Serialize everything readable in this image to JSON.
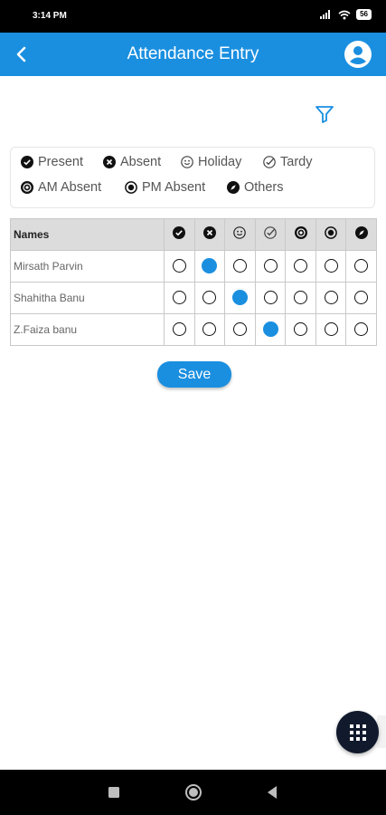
{
  "status_bar": {
    "time": "3:14 PM",
    "battery": "56",
    "icons": [
      "signal-icon",
      "wifi-icon",
      "battery-icon"
    ]
  },
  "header": {
    "title": "Attendance Entry",
    "back_icon": "chevron-left-icon",
    "profile_icon": "account-circle-icon",
    "color": "#1a8fe0"
  },
  "filter": {
    "icon": "filter-icon"
  },
  "legend": {
    "items": [
      {
        "label": "Present",
        "icon": "check-circle-icon"
      },
      {
        "label": "Absent",
        "icon": "x-circle-icon"
      },
      {
        "label": "Holiday",
        "icon": "smiley-icon"
      },
      {
        "label": "Tardy",
        "icon": "check-outline-icon"
      },
      {
        "label": "AM Absent",
        "icon": "target-icon"
      },
      {
        "label": "PM Absent",
        "icon": "radio-dot-icon"
      },
      {
        "label": "Others",
        "icon": "compass-icon"
      }
    ]
  },
  "table": {
    "names_header": "Names",
    "rows": [
      {
        "name": "Mirsath Parvin",
        "selected": 1
      },
      {
        "name": "Shahitha Banu",
        "selected": 2
      },
      {
        "name": "Z.Faiza banu",
        "selected": 3
      }
    ]
  },
  "save_label": "Save",
  "fab": {
    "icon": "grid-menu-icon",
    "color": "#111a2c"
  },
  "nav_bar": {
    "icons": [
      "square-recent-icon",
      "circle-home-icon",
      "triangle-back-icon"
    ]
  }
}
